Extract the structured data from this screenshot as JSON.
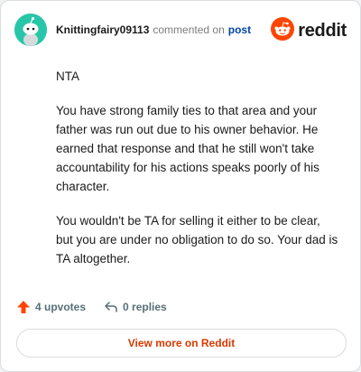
{
  "comment": {
    "author": "Knittingfairy09113",
    "action_text": "commented on",
    "post_link": "post",
    "paragraphs": [
      "NTA",
      "You have strong family ties to that area and your father was run out due to his owner behavior. He earned that response and that he still won't take accountability for his actions speaks poorly of his character.",
      "You wouldn't be TA for selling it either to be clear, but you are under no obligation to do so. Your dad is TA altogether."
    ]
  },
  "brand": {
    "name": "reddit",
    "icon": "reddit-logo-icon",
    "color": "#ff4500"
  },
  "avatar": {
    "icon": "snoo-avatar-icon",
    "color": "#28c6a8"
  },
  "actions": {
    "upvotes": "4 upvotes",
    "upvote_icon": "upvote-arrow-icon",
    "upvote_color": "#ff4500",
    "replies": "0 replies",
    "reply_icon": "reply-arrow-icon"
  },
  "cta": {
    "label": "View more on Reddit",
    "color": "#d93900"
  }
}
